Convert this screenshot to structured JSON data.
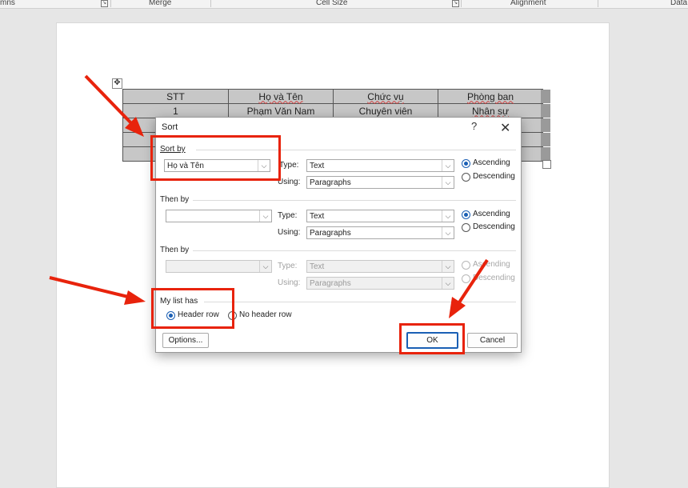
{
  "ribbon": {
    "groups": [
      "mns",
      "Merge",
      "Cell Size",
      "Alignment",
      "Data"
    ]
  },
  "table": {
    "header": [
      "STT",
      "Họ và Tên",
      "Chức vụ",
      "Phòng ban"
    ],
    "row1": [
      "1",
      "Phạm Văn Nam",
      "Chuyên viên",
      "Nhân sự"
    ]
  },
  "dialog": {
    "title": "Sort",
    "help": "?",
    "close": "✕",
    "sort_by": {
      "label": "Sort by",
      "column_value": "Họ và Tên",
      "type_label": "Type:",
      "type_value": "Text",
      "using_label": "Using:",
      "using_value": "Paragraphs",
      "ascending": "Ascending",
      "descending": "Descending"
    },
    "then_by_1": {
      "label": "Then by",
      "column_value": "",
      "type_label": "Type:",
      "type_value": "Text",
      "using_label": "Using:",
      "using_value": "Paragraphs",
      "ascending": "Ascending",
      "descending": "Descending"
    },
    "then_by_2": {
      "label": "Then by",
      "column_value": "",
      "type_label": "Type:",
      "type_value": "Text",
      "using_label": "Using:",
      "using_value": "Paragraphs",
      "ascending": "Ascending",
      "descending": "Descending"
    },
    "my_list_has": {
      "label": "My list has",
      "header_row": "Header row",
      "no_header_row": "No header row"
    },
    "buttons": {
      "options": "Options...",
      "ok": "OK",
      "cancel": "Cancel"
    }
  },
  "colors": {
    "highlight": "#e8230c",
    "accent": "#1a5fb4"
  }
}
